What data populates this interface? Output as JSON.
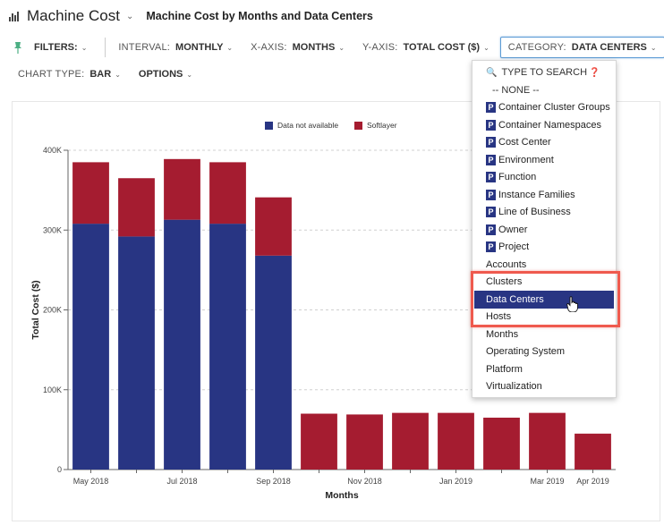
{
  "header": {
    "title": "Machine Cost",
    "subtitle": "Machine Cost by Months and Data Centers"
  },
  "toolbar": {
    "filters_label": "FILTERS:",
    "interval_label": "INTERVAL:",
    "interval_value": "MONTHLY",
    "xaxis_label": "X-AXIS:",
    "xaxis_value": "MONTHS",
    "yaxis_label": "Y-AXIS:",
    "yaxis_value": "TOTAL COST ($)",
    "category_label": "CATEGORY:",
    "category_value": "DATA CENTERS",
    "chart_type_label": "CHART TYPE:",
    "chart_type_value": "BAR",
    "options_label": "OPTIONS"
  },
  "dropdown": {
    "search_placeholder": "TYPE TO SEARCH",
    "none_label": "-- NONE --",
    "badge_letter": "P",
    "items": [
      {
        "label": "Container Cluster Groups",
        "badge": true
      },
      {
        "label": "Container Namespaces",
        "badge": true
      },
      {
        "label": "Cost Center",
        "badge": true
      },
      {
        "label": "Environment",
        "badge": true
      },
      {
        "label": "Function",
        "badge": true
      },
      {
        "label": "Instance Families",
        "badge": true
      },
      {
        "label": "Line of Business",
        "badge": true
      },
      {
        "label": "Owner",
        "badge": true
      },
      {
        "label": "Project",
        "badge": true
      },
      {
        "label": "Accounts",
        "badge": false
      },
      {
        "label": "Clusters",
        "badge": false
      },
      {
        "label": "Data Centers",
        "badge": false,
        "selected": true
      },
      {
        "label": "Hosts",
        "badge": false
      },
      {
        "label": "Months",
        "badge": false
      },
      {
        "label": "Operating System",
        "badge": false
      },
      {
        "label": "Platform",
        "badge": false
      },
      {
        "label": "Virtualization",
        "badge": false
      }
    ]
  },
  "colors": {
    "series_na": "#283583",
    "series_softlayer": "#a51c30",
    "selected_bg": "#283583",
    "highlight": "#ef5a4e",
    "pin": "#4caf84"
  },
  "chart_data": {
    "type": "bar",
    "stacked": true,
    "xlabel": "Months",
    "ylabel": "Total Cost ($)",
    "ylim": [
      0,
      400000
    ],
    "y_ticks": [
      "0",
      "100K",
      "200K",
      "300K",
      "400K"
    ],
    "y_tick_values": [
      0,
      100000,
      200000,
      300000,
      400000
    ],
    "x_tick_labels": [
      "May 2018",
      "Jul 2018",
      "Sep 2018",
      "Nov 2018",
      "Jan 2019",
      "Mar 2019",
      "Apr 2019"
    ],
    "x_tick_indices": [
      0,
      2,
      4,
      6,
      8,
      10,
      11
    ],
    "bar_count": 12,
    "grid": true,
    "legend_position": "top",
    "series": [
      {
        "name": "Data not available",
        "color": "#283583",
        "values": [
          308000,
          292000,
          313000,
          308000,
          268000,
          0,
          0,
          0,
          0,
          0,
          0,
          0
        ]
      },
      {
        "name": "Softlayer",
        "color": "#a51c30",
        "values": [
          77000,
          73000,
          76000,
          77000,
          73000,
          70000,
          69000,
          71000,
          71000,
          65000,
          71000,
          45000
        ]
      }
    ]
  }
}
